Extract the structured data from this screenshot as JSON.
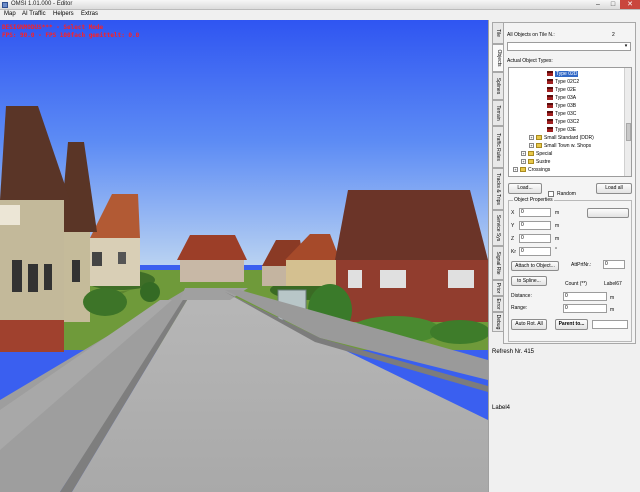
{
  "window": {
    "title": "OMSI 1.01.000 - Editor",
    "min_glyph": "–",
    "max_glyph": "□",
    "close_glyph": "✕"
  },
  "menu": {
    "items": [
      "Map",
      "AI Traffic",
      "Helpers",
      "Extras"
    ]
  },
  "overlay": {
    "line1": "DESIGNMODUS*** - Select Mode",
    "line2": "FPS: 90.0 - FPS 100fach gemittelt: 0.0"
  },
  "tabs": [
    "Tile",
    "Objects",
    "Splines",
    "Terrain",
    "Traffic Rules",
    "Tracks & Trips",
    "Service Sys",
    "Signal Rte",
    "Prior",
    "Error",
    "Debug"
  ],
  "objects": {
    "all_objects_label": "All Objects on Tile N.:",
    "tile_count": "2",
    "actual_types_label": "Actual Object Types:",
    "tree": [
      {
        "label": "Type 02D",
        "kind": "house",
        "indent": 3,
        "selected": true
      },
      {
        "label": "Type 02C2",
        "kind": "house",
        "indent": 3
      },
      {
        "label": "Type 02E",
        "kind": "house",
        "indent": 3
      },
      {
        "label": "Type 03A",
        "kind": "house",
        "indent": 3
      },
      {
        "label": "Type 03B",
        "kind": "house",
        "indent": 3
      },
      {
        "label": "Type 03C",
        "kind": "house",
        "indent": 3
      },
      {
        "label": "Type 03C2",
        "kind": "house",
        "indent": 3
      },
      {
        "label": "Type 03E",
        "kind": "house",
        "indent": 3
      },
      {
        "label": "Small Standard (DDR)",
        "kind": "folder",
        "indent": 2,
        "expander": "+"
      },
      {
        "label": "Small Town w. Shops",
        "kind": "folder",
        "indent": 2,
        "expander": "+"
      },
      {
        "label": "Special",
        "kind": "folder",
        "indent": 1,
        "expander": "+"
      },
      {
        "label": "Sustre",
        "kind": "folder",
        "indent": 1,
        "expander": "+"
      },
      {
        "label": "Crossings",
        "kind": "folder",
        "indent": 0,
        "expander": "+"
      }
    ],
    "load_button": "Load...",
    "random_label": "Random",
    "load_all_button": "Load all",
    "props_legend": "Object Properties",
    "x_label": "X",
    "y_label": "Y",
    "z_label": "Z",
    "kr_label": "Kr",
    "x_value": "0",
    "y_value": "0",
    "z_value": "0",
    "kr_value": "0",
    "unit_m": "m",
    "unit_deg": "°",
    "attach_button": "Attach to Object...",
    "attr_label": "AttPrtNr.:",
    "attr_value": "0",
    "to_spline_button": "to Spline...",
    "count_label": "Count (**)",
    "label_name": "Label67",
    "distance_label": "Distance:",
    "distance_value": "0",
    "range_label": "Range:",
    "range_value": "0",
    "auto_rot_button": "Auto Rot. All",
    "parent_button": "Parent to..."
  },
  "status": {
    "refresh": "Refresh Nr. 415",
    "label4": "Label4"
  }
}
